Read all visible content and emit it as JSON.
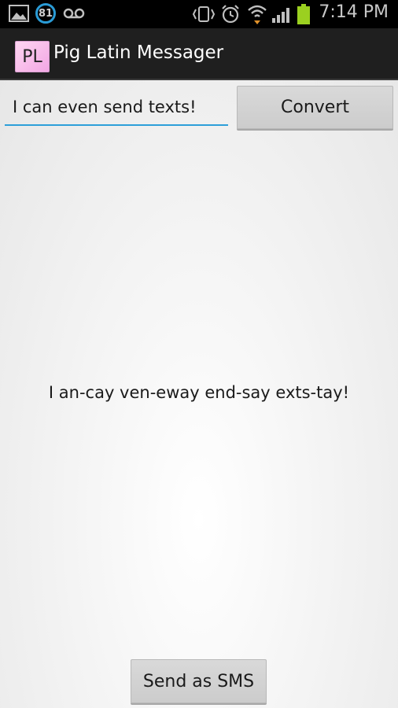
{
  "status_bar": {
    "notification_count": "81",
    "time": "7:14 PM",
    "icons": [
      "image-icon",
      "notification-count-icon",
      "voicemail-icon",
      "vibrate-icon",
      "alarm-icon",
      "wifi-icon",
      "signal-icon",
      "battery-icon"
    ]
  },
  "action_bar": {
    "icon_text": "PL",
    "title": "Pig Latin Messager"
  },
  "main": {
    "input_value": "I can even send texts!",
    "convert_label": "Convert",
    "result_text": "I an-cay ven-eway end-say exts-tay!",
    "send_label": "Send as SMS"
  },
  "colors": {
    "accent": "#2d9fd9",
    "battery": "#9bd020",
    "action_bar_bg": "#1f1f1f"
  }
}
